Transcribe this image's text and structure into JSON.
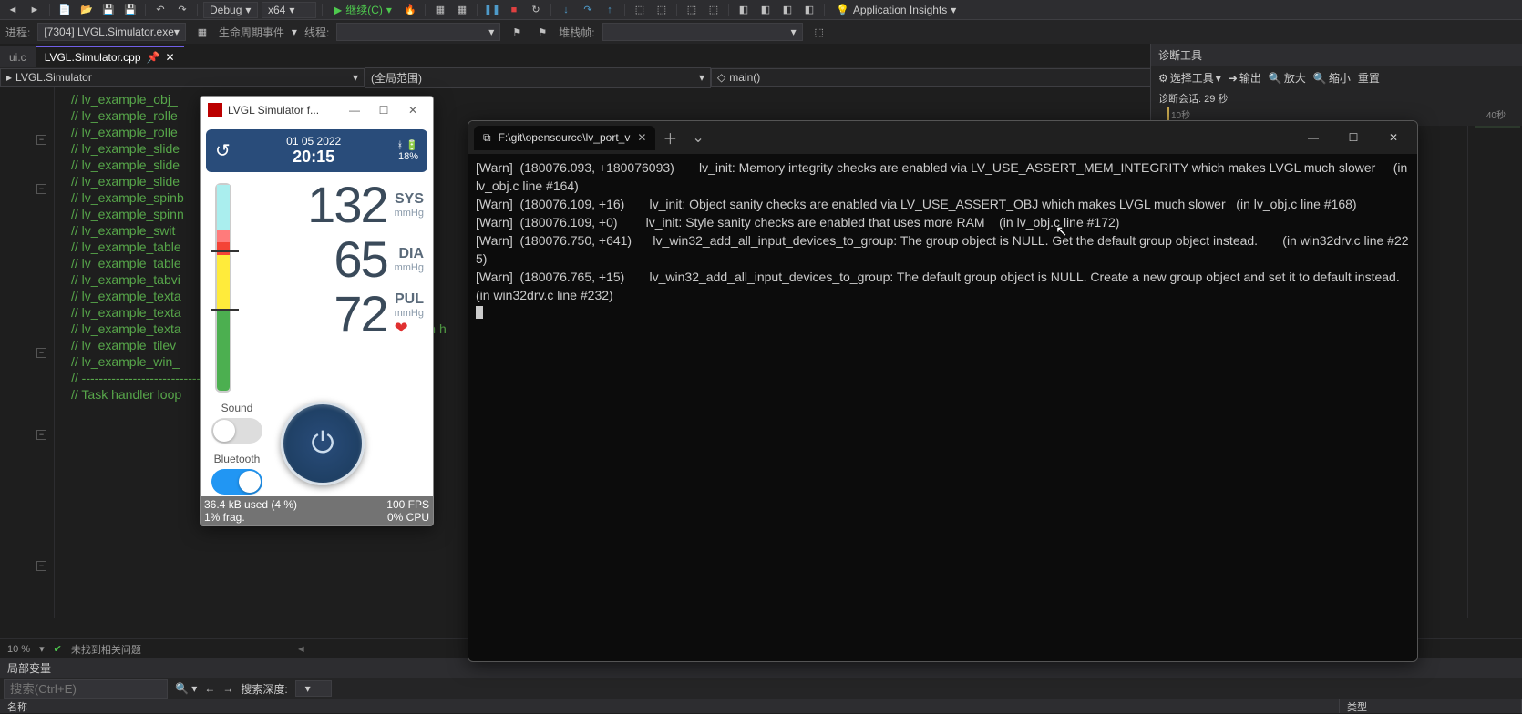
{
  "toolbar": {
    "config": "Debug",
    "platform": "x64",
    "continue_label": "继续(C)",
    "app_insights": "Application Insights"
  },
  "row2": {
    "process_label": "进程:",
    "process_value": "[7304] LVGL.Simulator.exe",
    "lifecycle_label": "生命周期事件",
    "thread_label": "线程:",
    "stackframe_label": "堆栈帧:"
  },
  "tabs": {
    "t0": "ui.c",
    "t1": "LVGL.Simulator.cpp"
  },
  "nav": {
    "scope": "LVGL.Simulator",
    "mid": "(全局范围)",
    "func": "main()"
  },
  "code": {
    "l1": "// lv_example_obj_",
    "l2": "",
    "l3": "// lv_example_rolle",
    "l4": "// lv_example_rolle",
    "l5": "",
    "l6": "// lv_example_slide",
    "l7": "// lv_example_slide",
    "l8": "// lv_example_slide",
    "l9": "",
    "l10": "// lv_example_spinb",
    "l11": "",
    "l12": "// lv_example_spinn",
    "l13": "",
    "l14": "// lv_example_swit",
    "l15": "",
    "l16": "// lv_example_table",
    "l17": "// lv_example_table",
    "l18": "",
    "l19": "// lv_example_tabvi",
    "l20": "",
    "l21": "// lv_example_texta",
    "l22": "// lv_example_texta",
    "l23": "// lv_example_texta",
    "l23b": "ton h",
    "l24": "",
    "l25": "// lv_example_tilev",
    "l26": "",
    "l27": "// lv_example_win_",
    "l28": "",
    "l29": "// ----------------------------------",
    "l30": "// Task handler loop"
  },
  "right_panel": {
    "title": "诊断工具",
    "select_tool": "选择工具",
    "output": "输出",
    "zoom_in": "放大",
    "zoom_out": "缩小",
    "reset": "重置",
    "session": "诊断会话: 29 秒",
    "tick1": "10秒",
    "tick2": "40秒"
  },
  "status": {
    "pct": "10 %",
    "issues": "未找到相关问题"
  },
  "locals": {
    "title": "局部变量",
    "search_ph": "搜索(Ctrl+E)",
    "depth_label": "搜索深度:",
    "col_name": "名称",
    "col_type": "类型"
  },
  "sim": {
    "title": "LVGL Simulator f...",
    "date": "01 05 2022",
    "time": "20:15",
    "battery": "18%",
    "sys_val": "132",
    "sys_lbl": "SYS",
    "sys_unit": "mmHg",
    "dia_val": "65",
    "dia_lbl": "DIA",
    "dia_unit": "mmHg",
    "pul_val": "72",
    "pul_lbl": "PUL",
    "pul_unit": "mmHg",
    "sound_lbl": "Sound",
    "bt_lbl": "Bluetooth",
    "mem": "36.4 kB used (4 %)",
    "frag": "1% frag.",
    "fps": "100 FPS",
    "cpu": "0% CPU"
  },
  "term": {
    "tab_title": "F:\\git\\opensource\\lv_port_v",
    "lines": "[Warn]  (180076.093, +180076093)       lv_init: Memory integrity checks are enabled via LV_USE_ASSERT_MEM_INTEGRITY which makes LVGL much slower     (in lv_obj.c line #164)\n[Warn]  (180076.109, +16)       lv_init: Object sanity checks are enabled via LV_USE_ASSERT_OBJ which makes LVGL much slower   (in lv_obj.c line #168)\n[Warn]  (180076.109, +0)        lv_init: Style sanity checks are enabled that uses more RAM    (in lv_obj.c line #172)\n[Warn]  (180076.750, +641)      lv_win32_add_all_input_devices_to_group: The group object is NULL. Get the default group object instead.       (in win32drv.c line #225)\n[Warn]  (180076.765, +15)       lv_win32_add_all_input_devices_to_group: The default group object is NULL. Create a new group object and set it to default instead.    (in win32drv.c line #232)"
  }
}
